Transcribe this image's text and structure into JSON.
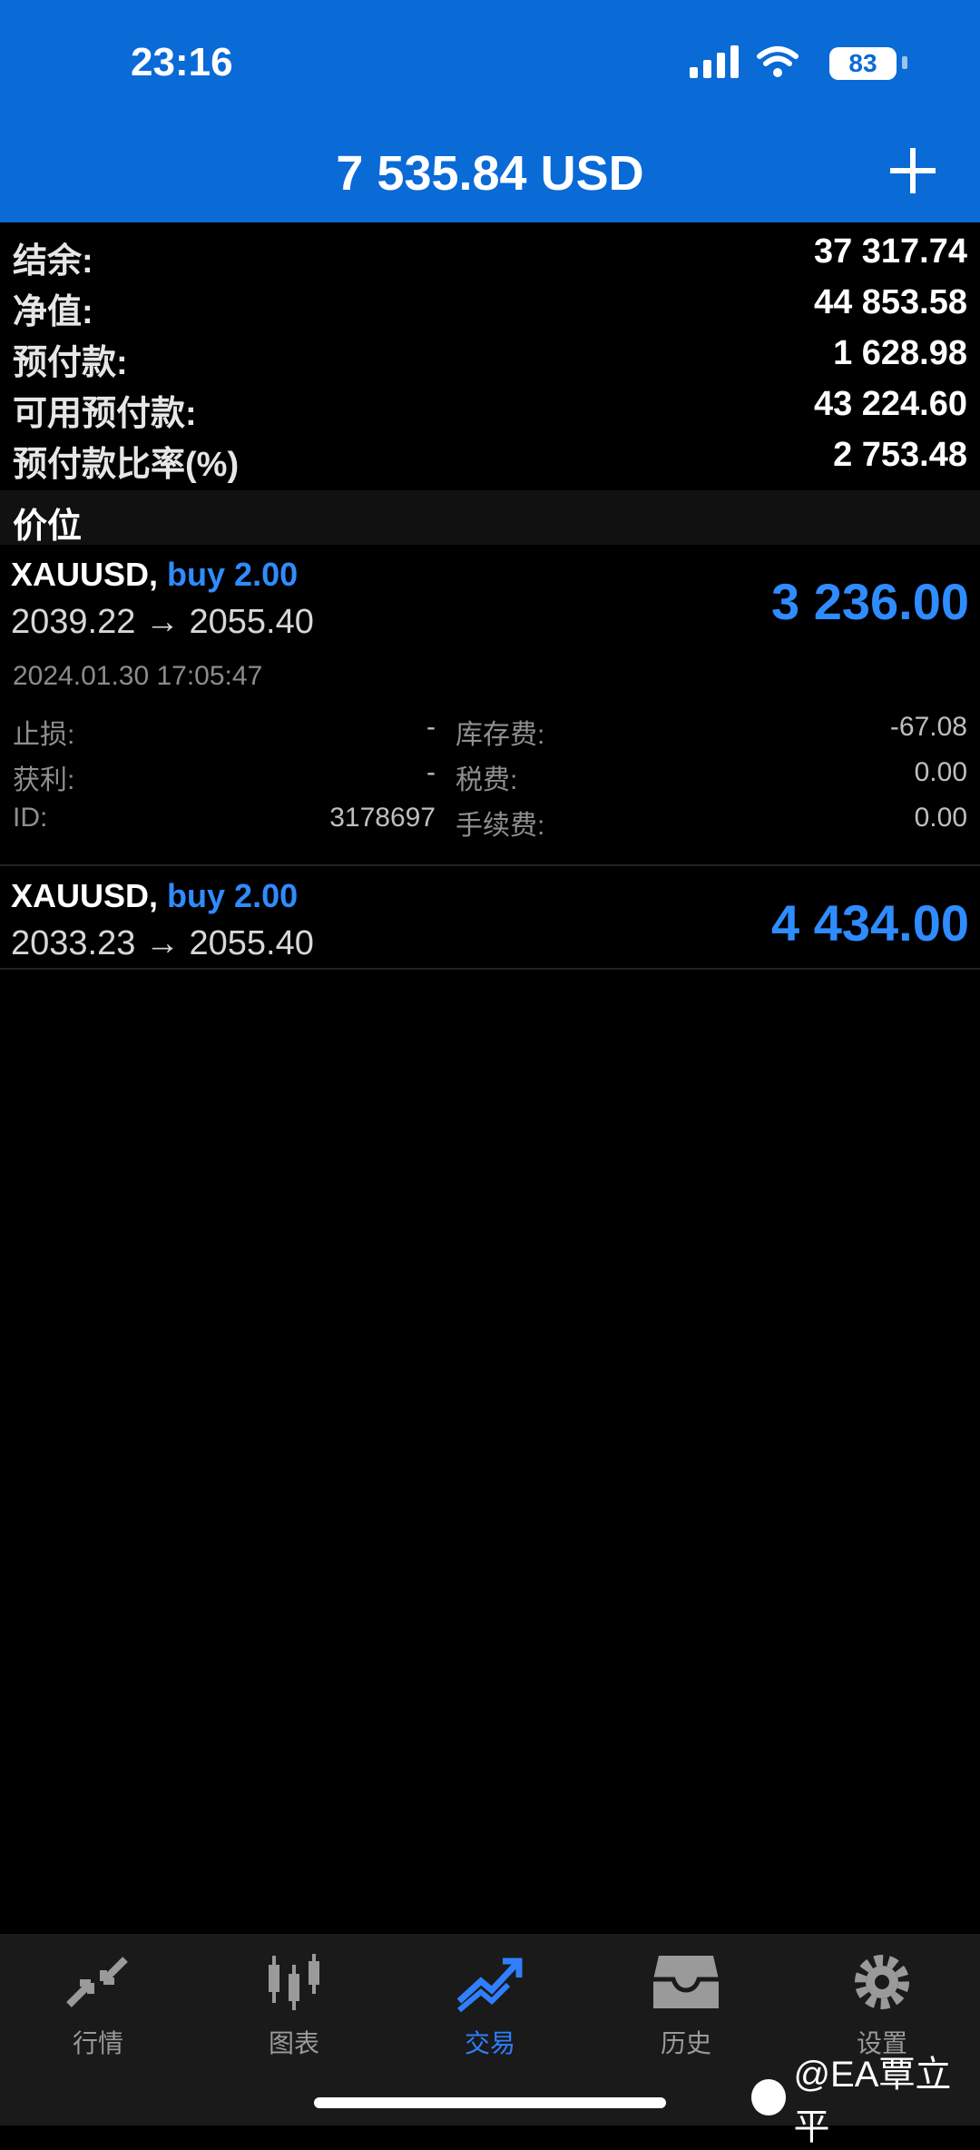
{
  "status_bar": {
    "time": "23:16",
    "battery": "83"
  },
  "header": {
    "title": "7 535.84 USD",
    "add_icon": "plus-icon"
  },
  "summary": [
    {
      "label": "结余:",
      "value": "37 317.74"
    },
    {
      "label": "净值:",
      "value": "44 853.58"
    },
    {
      "label": "预付款:",
      "value": "1 628.98"
    },
    {
      "label": "可用预付款:",
      "value": "43 224.60"
    },
    {
      "label": "预付款比率(%)",
      "value": "2 753.48"
    }
  ],
  "section_title": "价位",
  "positions": [
    {
      "symbol": "XAUUSD,",
      "side": "buy 2.00",
      "prices": "2039.22 → 2055.40",
      "profit": "3 236.00",
      "datetime": "2024.01.30 17:05:47",
      "details": {
        "sl_label": "止损:",
        "sl_value": "-",
        "swap_label": "库存费:",
        "swap_value": "-67.08",
        "tp_label": "获利:",
        "tp_value": "-",
        "tax_label": "税费:",
        "tax_value": "0.00",
        "id_label": "ID:",
        "id_value": "3178697",
        "fee_label": "手续费:",
        "fee_value": "0.00"
      }
    },
    {
      "symbol": "XAUUSD,",
      "side": "buy 2.00",
      "prices": "2033.23 → 2055.40",
      "profit": "4 434.00"
    }
  ],
  "tabs": [
    {
      "label": "行情",
      "icon": "quotes-icon"
    },
    {
      "label": "图表",
      "icon": "chart-icon"
    },
    {
      "label": "交易",
      "icon": "trade-icon",
      "active": true
    },
    {
      "label": "历史",
      "icon": "history-icon"
    },
    {
      "label": "设置",
      "icon": "settings-icon"
    }
  ],
  "watermark": "@EA覃立平",
  "colors": {
    "header": "#0a6ad6",
    "accent": "#2f8cff",
    "background": "#000000"
  }
}
